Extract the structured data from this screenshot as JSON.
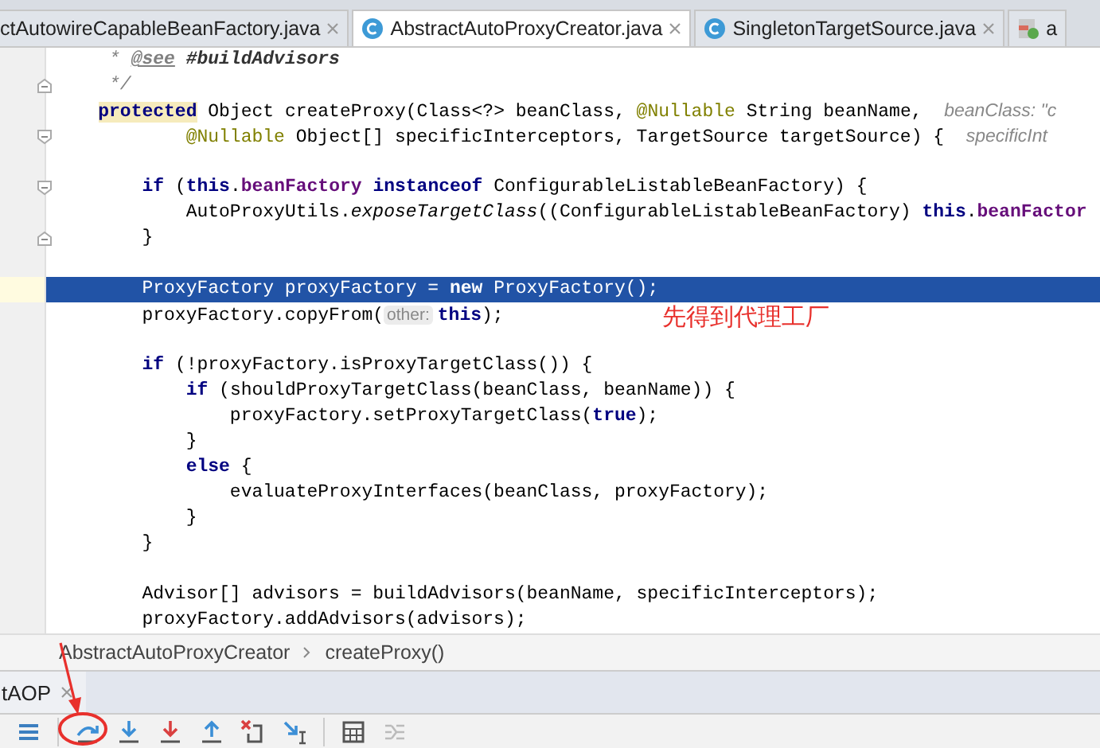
{
  "tabs": [
    {
      "label": "ctAutowireCapableBeanFactory.java",
      "selected": false
    },
    {
      "label": "AbstractAutoProxyCreator.java",
      "selected": true,
      "kind": "javaclass"
    },
    {
      "label": "SingletonTargetSource.java",
      "selected": false,
      "kind": "javaclass"
    },
    {
      "label": "a",
      "selected": false,
      "kind": "resource"
    }
  ],
  "editor": {
    "lines": [
      {
        "selected": false,
        "kind": "code",
        "segments": [
          {
            "kind": "doc",
            "text": "     *"
          },
          {
            "kind": "doctag",
            "text": " @see"
          },
          {
            "kind": "docref",
            "text": " #buildAdvisors"
          }
        ]
      },
      {
        "selected": false,
        "kind": "foldend",
        "segments": [
          {
            "kind": "doc",
            "text": "     */"
          }
        ]
      },
      {
        "selected": false,
        "kind": "code",
        "segments": [
          {
            "kind": "keyword_hl",
            "text": "    protected"
          },
          {
            "kind": "plain",
            "text": " Object createProxy(Class<?> beanClass, "
          },
          {
            "kind": "annotation",
            "text": "@Nullable"
          },
          {
            "kind": "plain",
            "text": " String beanName,  "
          },
          {
            "kind": "hint",
            "text": "beanClass: \"c"
          }
        ]
      },
      {
        "selected": false,
        "kind": "foldstart",
        "segments": [
          {
            "kind": "annotation",
            "text": "            @Nullable"
          },
          {
            "kind": "plain",
            "text": " Object[] specificInterceptors, TargetSource targetSource) {  "
          },
          {
            "kind": "hint",
            "text": "specificInt"
          }
        ]
      },
      {
        "selected": false,
        "kind": "code"
      },
      {
        "selected": false,
        "kind": "foldstart",
        "segments": [
          {
            "kind": "keyword",
            "text": "        if"
          },
          {
            "kind": "plain",
            "text": " ("
          },
          {
            "kind": "keyword",
            "text": "this"
          },
          {
            "kind": "plain",
            "text": "."
          },
          {
            "kind": "field",
            "text": "beanFactory"
          },
          {
            "kind": "keyword",
            "text": " instanceof"
          },
          {
            "kind": "plain",
            "text": " ConfigurableListableBeanFactory) {"
          }
        ]
      },
      {
        "selected": false,
        "kind": "code",
        "segments": [
          {
            "kind": "plain",
            "text": "            AutoProxyUtils."
          },
          {
            "kind": "static",
            "text": "exposeTargetClass"
          },
          {
            "kind": "plain",
            "text": "((ConfigurableListableBeanFactory) "
          },
          {
            "kind": "keyword",
            "text": "this"
          },
          {
            "kind": "plain",
            "text": "."
          },
          {
            "kind": "field",
            "text": "beanFactor"
          }
        ]
      },
      {
        "selected": false,
        "kind": "foldend",
        "segments": [
          {
            "kind": "plain",
            "text": "        }"
          }
        ]
      },
      {
        "selected": false,
        "kind": "code"
      },
      {
        "selected": true,
        "kind": "code",
        "segments": [
          {
            "kind": "plain",
            "text": "        ProxyFactory proxyFactory = "
          },
          {
            "kind": "keyword",
            "text": "new"
          },
          {
            "kind": "plain",
            "text": " ProxyFactory();"
          }
        ]
      },
      {
        "selected": false,
        "kind": "code",
        "segments": [
          {
            "kind": "plain",
            "text": "        proxyFactory.copyFrom("
          },
          {
            "kind": "param",
            "text": "other:"
          },
          {
            "kind": "keyword",
            "text": "this"
          },
          {
            "kind": "plain",
            "text": ");"
          }
        ]
      },
      {
        "selected": false,
        "kind": "code"
      },
      {
        "selected": false,
        "kind": "code",
        "segments": [
          {
            "kind": "keyword",
            "text": "        if"
          },
          {
            "kind": "plain",
            "text": " (!proxyFactory.isProxyTargetClass()) {"
          }
        ]
      },
      {
        "selected": false,
        "kind": "code",
        "segments": [
          {
            "kind": "keyword",
            "text": "            if"
          },
          {
            "kind": "plain",
            "text": " (shouldProxyTargetClass(beanClass, beanName)) {"
          }
        ]
      },
      {
        "selected": false,
        "kind": "code",
        "segments": [
          {
            "kind": "plain",
            "text": "                proxyFactory.setProxyTargetClass("
          },
          {
            "kind": "keyword",
            "text": "true"
          },
          {
            "kind": "plain",
            "text": ");"
          }
        ]
      },
      {
        "selected": false,
        "kind": "code",
        "segments": [
          {
            "kind": "plain",
            "text": "            }"
          }
        ]
      },
      {
        "selected": false,
        "kind": "code",
        "segments": [
          {
            "kind": "keyword",
            "text": "            else"
          },
          {
            "kind": "plain",
            "text": " {"
          }
        ]
      },
      {
        "selected": false,
        "kind": "code",
        "segments": [
          {
            "kind": "plain",
            "text": "                evaluateProxyInterfaces(beanClass, proxyFactory);"
          }
        ]
      },
      {
        "selected": false,
        "kind": "code",
        "segments": [
          {
            "kind": "plain",
            "text": "            }"
          }
        ]
      },
      {
        "selected": false,
        "kind": "code",
        "segments": [
          {
            "kind": "plain",
            "text": "        }"
          }
        ]
      },
      {
        "selected": false,
        "kind": "code"
      },
      {
        "selected": false,
        "kind": "code",
        "segments": [
          {
            "kind": "plain",
            "text": "        Advisor[] advisors = buildAdvisors(beanName, specificInterceptors);"
          }
        ]
      },
      {
        "selected": false,
        "kind": "code",
        "segments": [
          {
            "kind": "plain",
            "text": "        proxyFactory.addAdvisors(advisors);"
          }
        ]
      }
    ],
    "note": "先得到代理工厂"
  },
  "breadcrumb": [
    {
      "label": "AbstractAutoProxyCreator"
    },
    {
      "label": "createProxy()"
    }
  ],
  "debug_tab": {
    "label": "tAOP"
  }
}
